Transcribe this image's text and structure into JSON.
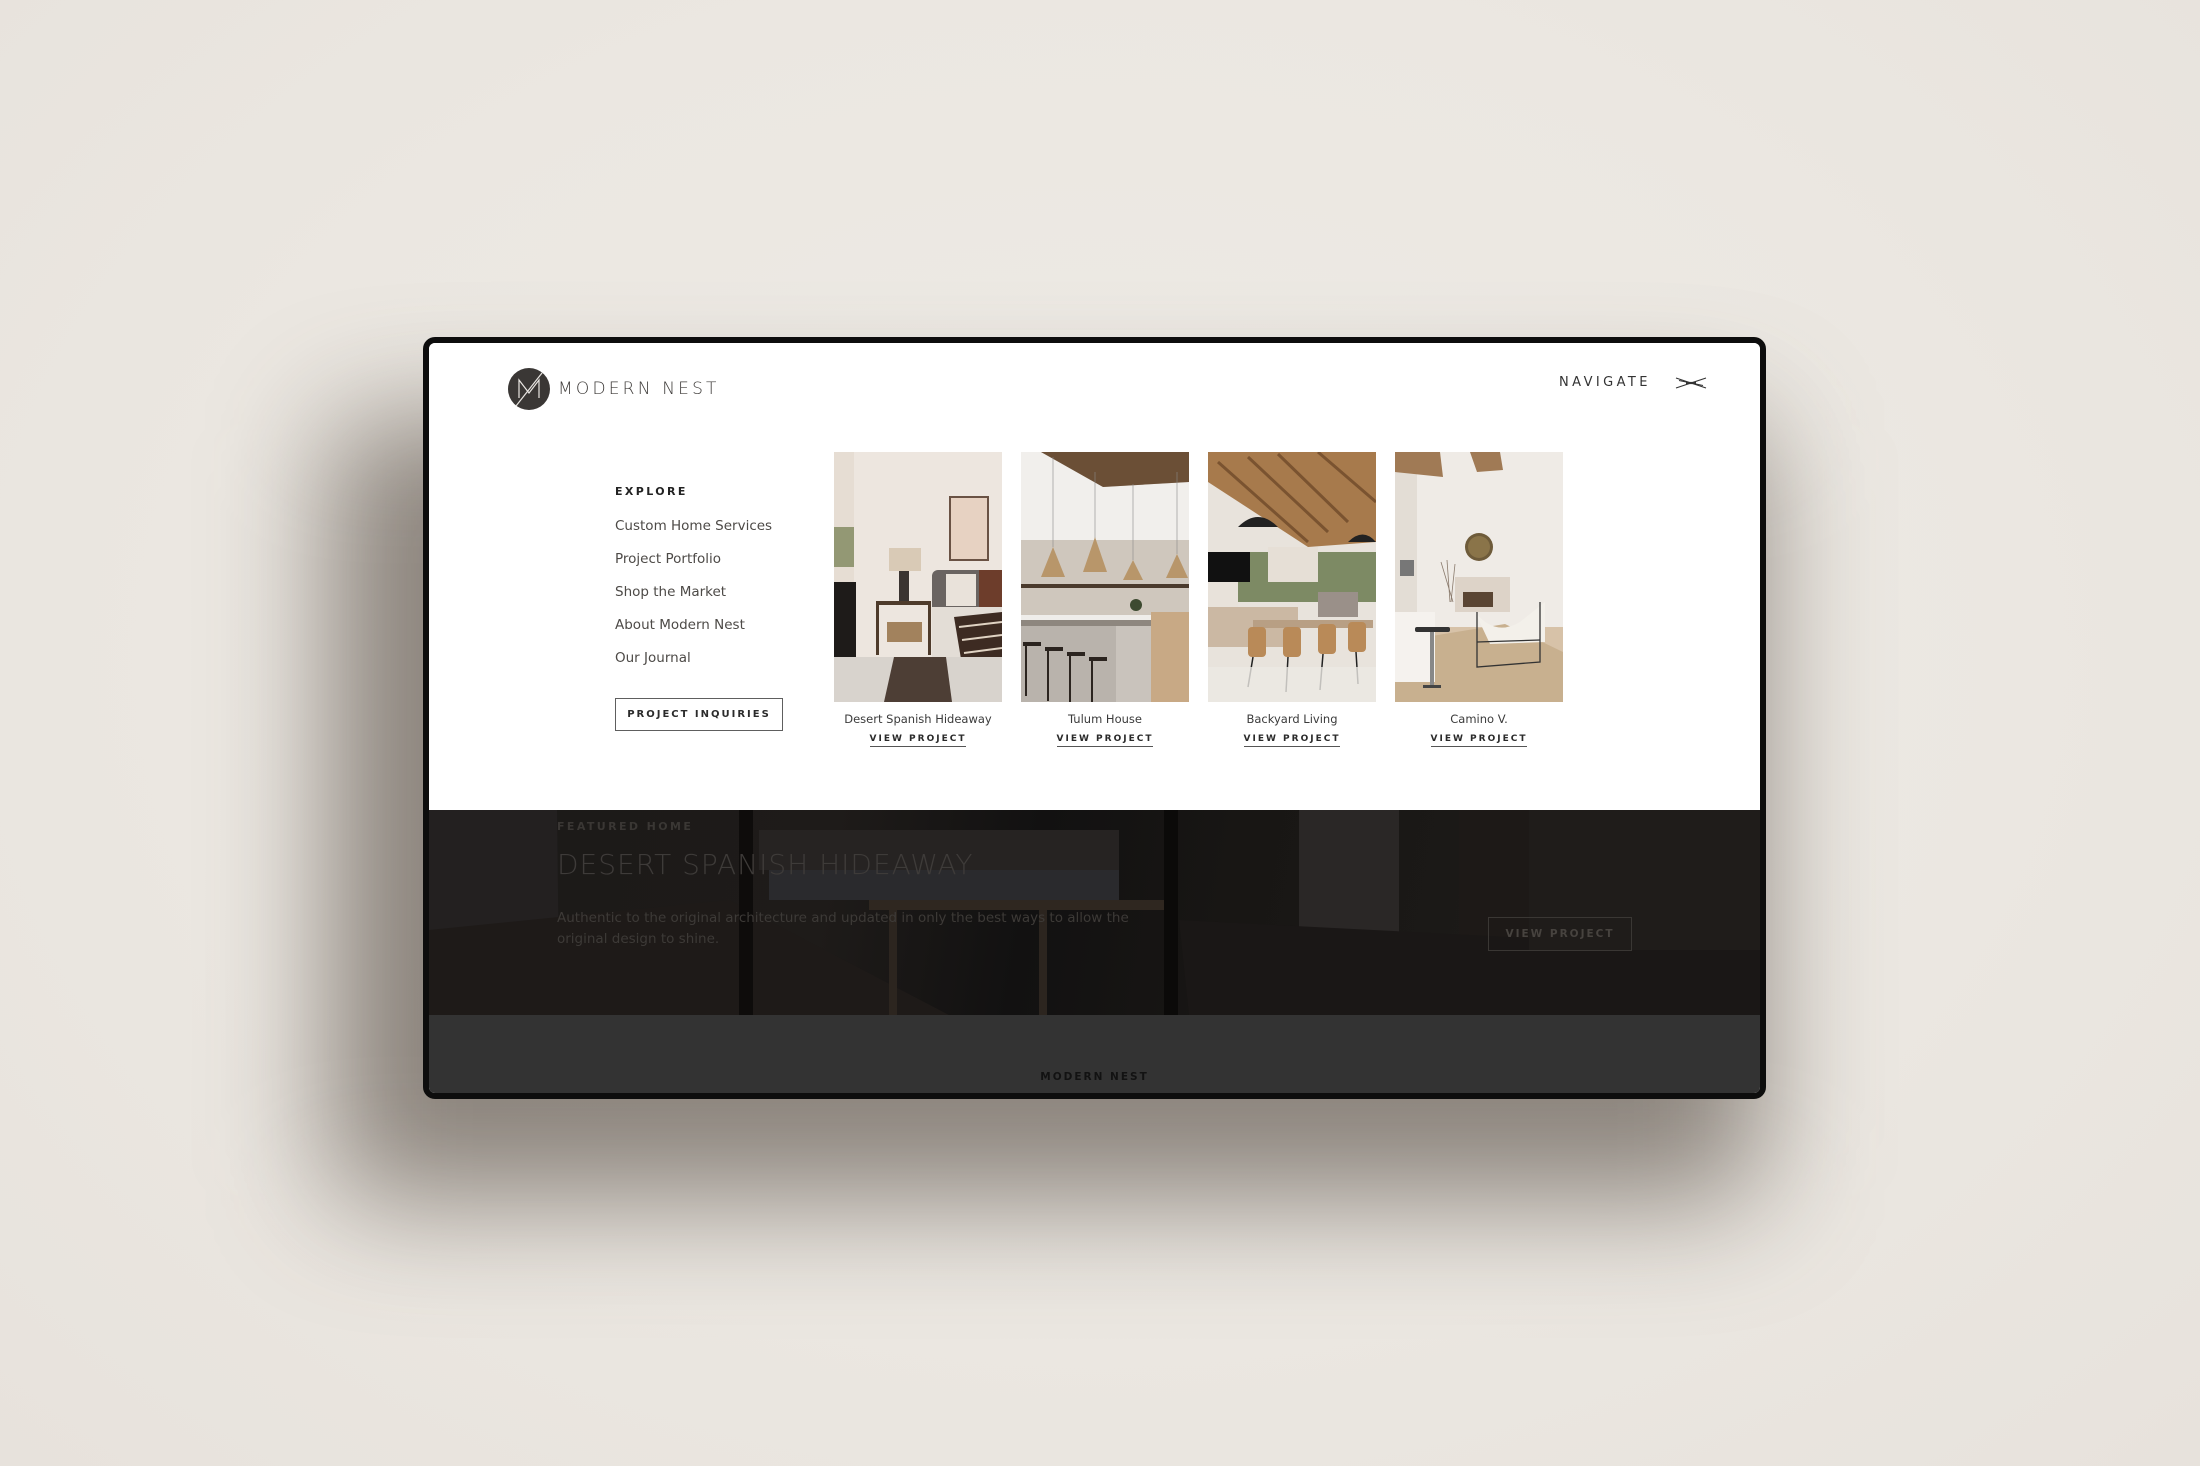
{
  "brand": {
    "name": "MODERN NEST",
    "logo_icon": "monogram-m-icon"
  },
  "header": {
    "nav_label": "NAVIGATE",
    "nav_icon": "close-bowtie-icon"
  },
  "menu": {
    "section_title": "EXPLORE",
    "items": [
      {
        "label": "Custom Home Services"
      },
      {
        "label": "Project Portfolio"
      },
      {
        "label": "Shop the Market"
      },
      {
        "label": "About Modern Nest"
      },
      {
        "label": "Our Journal"
      }
    ],
    "cta_label": "PROJECT INQUIRIES"
  },
  "projects": [
    {
      "title": "Desert Spanish Hideaway",
      "link_label": "VIEW PROJECT"
    },
    {
      "title": "Tulum House",
      "link_label": "VIEW PROJECT"
    },
    {
      "title": "Backyard Living",
      "link_label": "VIEW PROJECT"
    },
    {
      "title": "Camino V.",
      "link_label": "VIEW PROJECT"
    }
  ],
  "featured": {
    "label": "FEATURED HOME",
    "title": "DESERT SPANISH HIDEAWAY",
    "description": "Authentic to the original architecture and updated in only the best ways to allow the original design to shine.",
    "button_label": "VIEW PROJECT"
  },
  "footer": {
    "brand": "MODERN NEST"
  },
  "colors": {
    "page_background": "#ece8e3",
    "frame": "#0d0d0d",
    "menu_background": "#ffffff",
    "text_dark": "#333333",
    "footer_background": "#333333"
  }
}
